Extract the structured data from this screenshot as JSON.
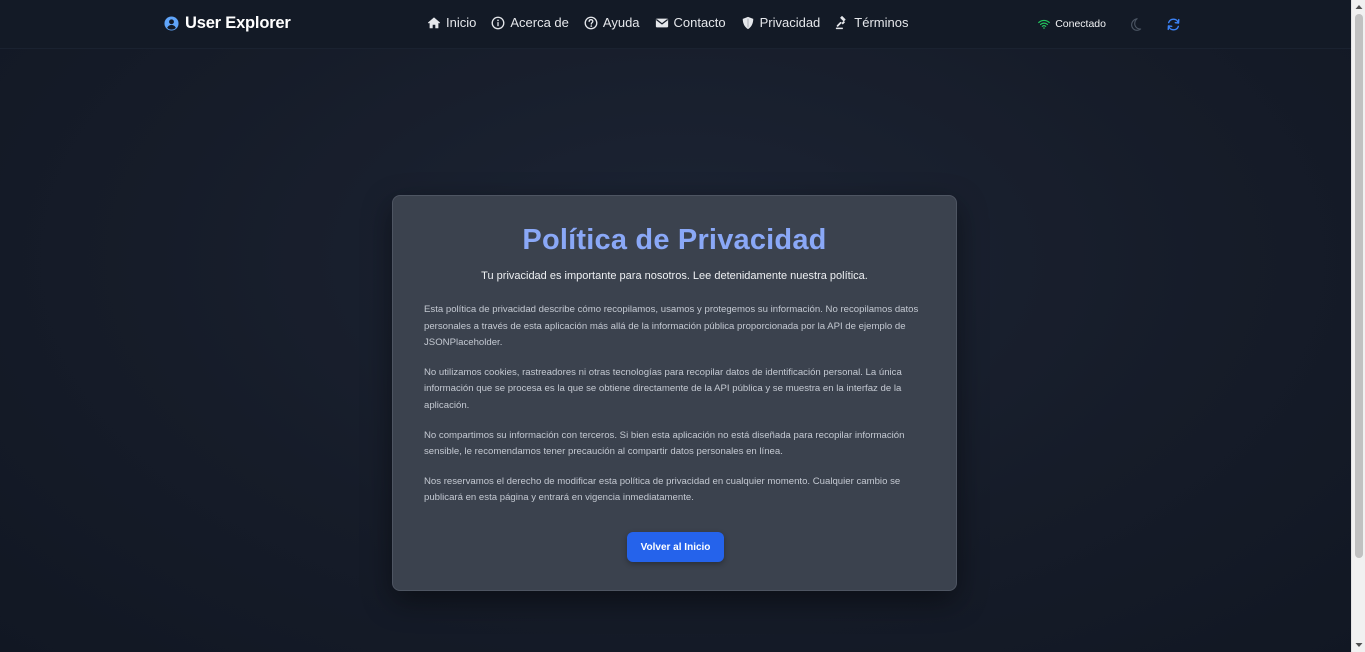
{
  "navbar": {
    "brand": "User Explorer",
    "brand_icon": "user-circle-icon",
    "links": [
      {
        "label": "Inicio",
        "icon": "home-icon"
      },
      {
        "label": "Acerca de",
        "icon": "info-icon"
      },
      {
        "label": "Ayuda",
        "icon": "help-icon"
      },
      {
        "label": "Contacto",
        "icon": "mail-icon"
      },
      {
        "label": "Privacidad",
        "icon": "shield-icon"
      },
      {
        "label": "Términos",
        "icon": "gavel-icon"
      }
    ],
    "status": "Conectado",
    "status_icon": "wifi-icon",
    "theme_icon": "moon-icon",
    "refresh_icon": "refresh-icon"
  },
  "card": {
    "title": "Política de Privacidad",
    "subtitle": "Tu privacidad es importante para nosotros. Lee detenidamente nuestra política.",
    "paragraphs": [
      "Esta política de privacidad describe cómo recopilamos, usamos y protegemos su información. No recopilamos datos personales a través de esta aplicación más allá de la información pública proporcionada por la API de ejemplo de JSONPlaceholder.",
      "No utilizamos cookies, rastreadores ni otras tecnologías para recopilar datos de identificación personal. La única información que se procesa es la que se obtiene directamente de la API pública y se muestra en la interfaz de la aplicación.",
      "No compartimos su información con terceros. Si bien esta aplicación no está diseñada para recopilar información sensible, le recomendamos tener precaución al compartir datos personales en línea.",
      "Nos reservamos el derecho de modificar esta política de privacidad en cualquier momento. Cualquier cambio se publicará en esta página y entrará en vigencia inmediatamente."
    ],
    "button": "Volver al Inicio"
  },
  "colors": {
    "accent": "#2563eb",
    "title": "#8aa8f7",
    "brand_icon": "#60a5fa",
    "status_ok": "#22c55e",
    "refresh": "#3b82f6"
  }
}
